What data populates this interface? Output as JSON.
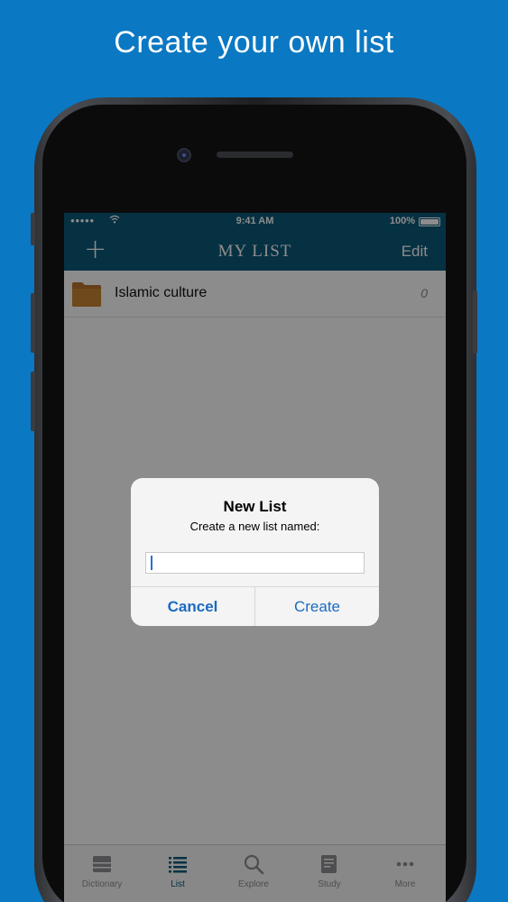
{
  "headline": "Create your own list",
  "status_bar": {
    "signal": "●●●●●",
    "time": "9:41 AM",
    "battery": "100%"
  },
  "nav": {
    "add_icon": "plus-icon",
    "add_label": "+",
    "title": "MY LIST",
    "edit_label": "Edit"
  },
  "list": {
    "items": [
      {
        "icon": "folder-icon",
        "label": "Islamic culture",
        "count": "0"
      }
    ]
  },
  "alert": {
    "title": "New List",
    "message": "Create a new list named:",
    "input_value": "",
    "cancel_label": "Cancel",
    "create_label": "Create"
  },
  "tab_bar": {
    "tabs": [
      {
        "label": "Dictionary",
        "icon": "dictionary-icon",
        "active": false
      },
      {
        "label": "List",
        "icon": "list-icon",
        "active": true
      },
      {
        "label": "Explore",
        "icon": "search-icon",
        "active": false
      },
      {
        "label": "Study",
        "icon": "study-icon",
        "active": false
      },
      {
        "label": "More",
        "icon": "more-icon",
        "active": false
      }
    ]
  },
  "colors": {
    "background": "#0a78c2",
    "nav_bar": "#0b5a7a",
    "accent": "#1a6bc0",
    "folder": "#b8732a"
  }
}
